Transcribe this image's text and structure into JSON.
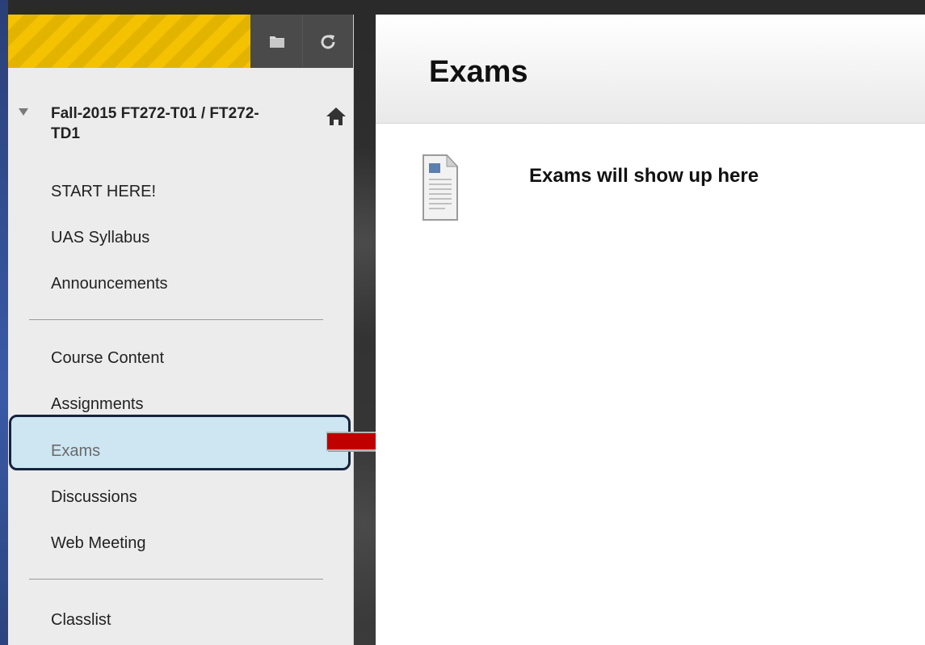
{
  "sidebar": {
    "course_title": "Fall-2015 FT272-T01 / FT272-TD1",
    "items_group1": [
      "START HERE!",
      "UAS Syllabus",
      "Announcements"
    ],
    "items_group2": [
      "Course Content",
      "Assignments",
      "Exams",
      "Discussions",
      "Web Meeting"
    ],
    "items_group3": [
      "Classlist"
    ],
    "active_item": "Exams"
  },
  "main": {
    "title": "Exams",
    "content_items": [
      {
        "title": "Exams will show up here",
        "icon": "document-icon"
      }
    ]
  },
  "icons": {
    "folder": "folder-icon",
    "refresh": "refresh-icon",
    "home": "home-icon",
    "arrow": "arrow-right-icon"
  },
  "colors": {
    "accent_yellow": "#f4c200",
    "active_bg": "#cde6f2",
    "active_border": "#14243e",
    "arrow": "#c00000"
  }
}
